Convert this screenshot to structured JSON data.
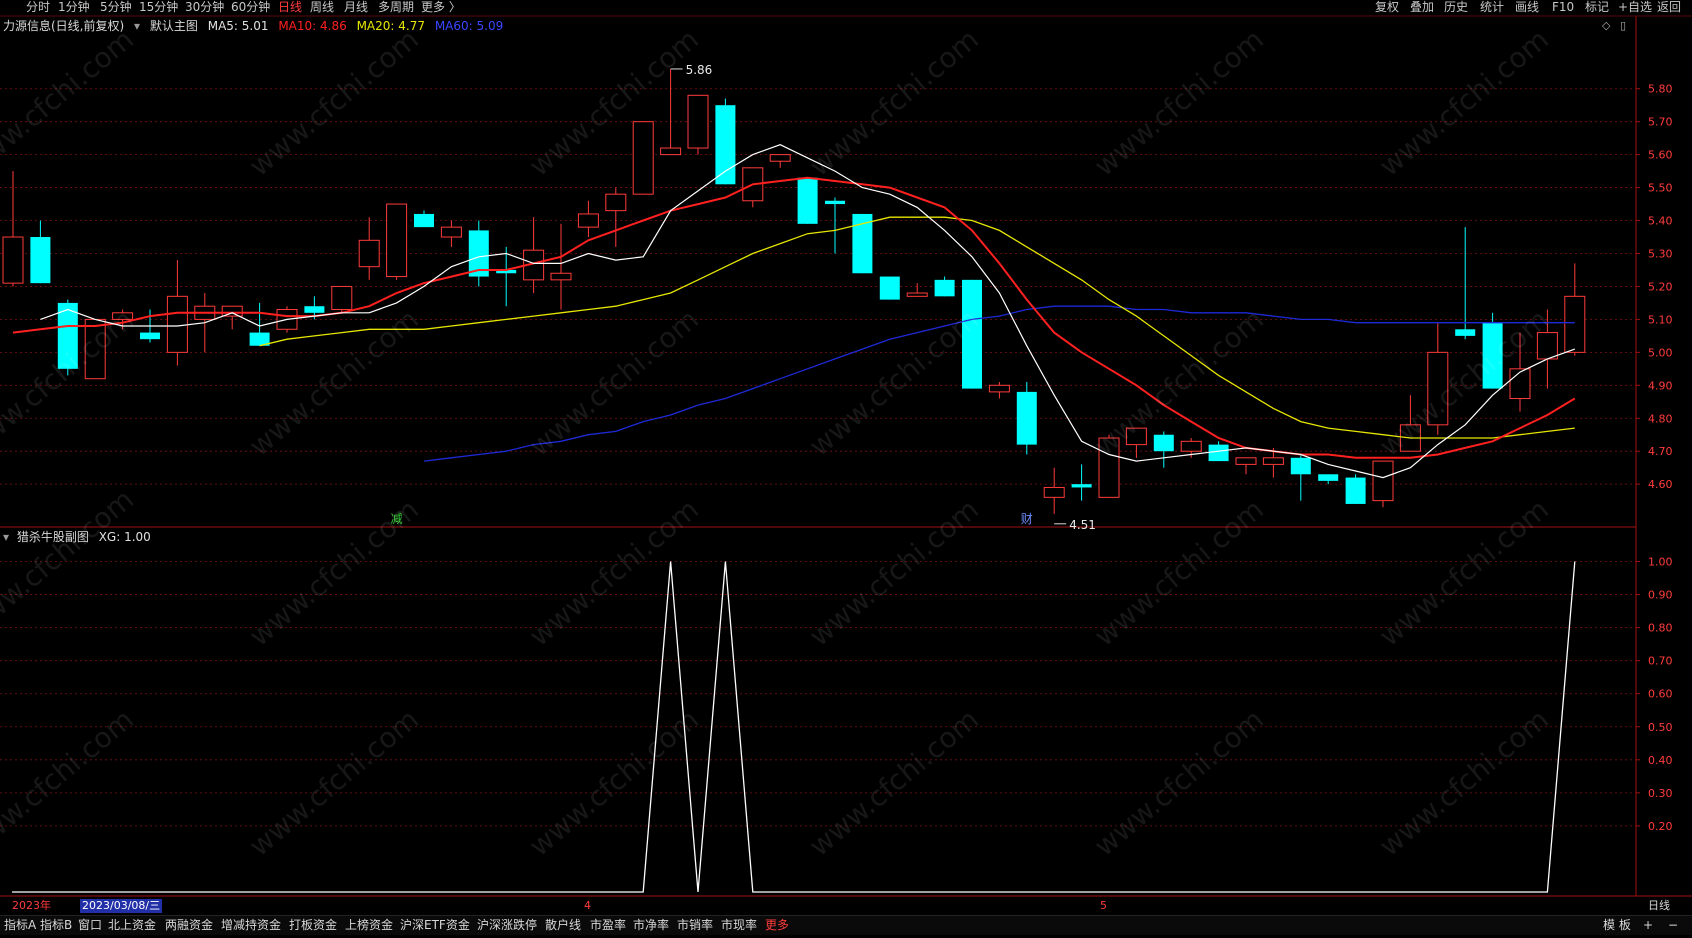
{
  "top_tabs": [
    "分时",
    "1分钟",
    "5分钟",
    "15分钟",
    "30分钟",
    "60分钟",
    "日线",
    "周线",
    "月线",
    "多周期",
    "更多 〉"
  ],
  "active_tab": "日线",
  "right_tools": [
    "复权",
    "叠加",
    "历史",
    "统计",
    "画线",
    "F10",
    "标记",
    "+自选",
    "返回"
  ],
  "main_title": {
    "stock": "力源信息(日线,前复权)",
    "template": "默认主图",
    "ma5": "MA5: 5.01",
    "ma10": "MA10: 4.86",
    "ma20": "MA20: 4.77",
    "ma60": "MA60: 5.09"
  },
  "sub_title": {
    "name": "猎杀牛股副图",
    "value": "XG: 1.00"
  },
  "markers": {
    "high": "5.86",
    "low": "4.51",
    "m1": "减",
    "m2": "财"
  },
  "date_bar": {
    "year": "2023年",
    "cursor_date": "2023/03/08/三",
    "m4": "4",
    "m5": "5",
    "period": "日线"
  },
  "bottom_tabs": [
    "指标A",
    "指标B",
    "窗口",
    "北上资金",
    "两融资金",
    "增减持资金",
    "打板资金",
    "上榜资金",
    "沪深ETF资金",
    "沪深涨跌停",
    "散户线",
    "市盈率",
    "市净率",
    "市销率",
    "市现率",
    "更多"
  ],
  "bottom_right": [
    "模 板",
    "+",
    "−"
  ],
  "watermark": "www.cfchi.com",
  "colors": {
    "up": "#ff3b3b",
    "down": "#00ffff",
    "ma5": "#ffffff",
    "ma10": "#ff2020",
    "ma20": "#e6e600",
    "ma60": "#1e2ad8",
    "grid": "#7a1010",
    "xg": "#ffffff"
  },
  "chart_data": [
    {
      "type": "candlestick",
      "title": "力源信息(日线,前复权)",
      "ylim": [
        4.47,
        5.96
      ],
      "y_ticks": [
        4.6,
        4.7,
        4.8,
        4.9,
        5.0,
        5.1,
        5.2,
        5.3,
        5.4,
        5.5,
        5.6,
        5.7,
        5.8
      ],
      "high_label": 5.86,
      "low_label": 4.51,
      "ohlc": [
        [
          5.21,
          5.55,
          5.2,
          5.35
        ],
        [
          5.35,
          5.4,
          5.21,
          5.21
        ],
        [
          5.15,
          5.16,
          4.93,
          4.95
        ],
        [
          4.92,
          5.1,
          4.92,
          5.1
        ],
        [
          5.1,
          5.13,
          5.07,
          5.12
        ],
        [
          5.06,
          5.13,
          5.03,
          5.04
        ],
        [
          5.0,
          5.28,
          4.96,
          5.17
        ],
        [
          5.1,
          5.18,
          5.0,
          5.14
        ],
        [
          5.11,
          5.14,
          5.07,
          5.14
        ],
        [
          5.06,
          5.15,
          5.02,
          5.02
        ],
        [
          5.07,
          5.14,
          5.06,
          5.13
        ],
        [
          5.14,
          5.17,
          5.1,
          5.12
        ],
        [
          5.13,
          5.2,
          5.12,
          5.2
        ],
        [
          5.26,
          5.41,
          5.22,
          5.34
        ],
        [
          5.23,
          5.45,
          5.22,
          5.45
        ],
        [
          5.42,
          5.43,
          5.38,
          5.38
        ],
        [
          5.35,
          5.4,
          5.32,
          5.38
        ],
        [
          5.37,
          5.4,
          5.2,
          5.23
        ],
        [
          5.25,
          5.32,
          5.14,
          5.24
        ],
        [
          5.22,
          5.41,
          5.18,
          5.31
        ],
        [
          5.22,
          5.39,
          5.13,
          5.24
        ],
        [
          5.38,
          5.46,
          5.35,
          5.42
        ],
        [
          5.43,
          5.5,
          5.32,
          5.48
        ],
        [
          5.48,
          5.7,
          5.48,
          5.7
        ],
        [
          5.6,
          5.86,
          5.6,
          5.62
        ],
        [
          5.62,
          5.78,
          5.6,
          5.78
        ],
        [
          5.75,
          5.77,
          5.51,
          5.51
        ],
        [
          5.46,
          5.56,
          5.44,
          5.56
        ],
        [
          5.58,
          5.6,
          5.56,
          5.6
        ],
        [
          5.53,
          5.53,
          5.39,
          5.39
        ],
        [
          5.46,
          5.47,
          5.3,
          5.45
        ],
        [
          5.42,
          5.42,
          5.24,
          5.24
        ],
        [
          5.23,
          5.23,
          5.16,
          5.16
        ],
        [
          5.17,
          5.21,
          5.17,
          5.18
        ],
        [
          5.22,
          5.23,
          5.17,
          5.17
        ],
        [
          5.22,
          5.22,
          4.89,
          4.89
        ],
        [
          4.88,
          4.91,
          4.86,
          4.9
        ],
        [
          4.88,
          4.91,
          4.69,
          4.72
        ],
        [
          4.56,
          4.65,
          4.51,
          4.59
        ],
        [
          4.6,
          4.66,
          4.55,
          4.59
        ],
        [
          4.56,
          4.75,
          4.56,
          4.74
        ],
        [
          4.72,
          4.77,
          4.68,
          4.77
        ],
        [
          4.75,
          4.76,
          4.65,
          4.7
        ],
        [
          4.7,
          4.74,
          4.68,
          4.73
        ],
        [
          4.72,
          4.73,
          4.67,
          4.67
        ],
        [
          4.66,
          4.68,
          4.63,
          4.68
        ],
        [
          4.66,
          4.71,
          4.62,
          4.68
        ],
        [
          4.68,
          4.69,
          4.55,
          4.63
        ],
        [
          4.63,
          4.63,
          4.6,
          4.61
        ],
        [
          4.62,
          4.63,
          4.54,
          4.54
        ],
        [
          4.55,
          4.67,
          4.53,
          4.67
        ],
        [
          4.7,
          4.87,
          4.7,
          4.78
        ],
        [
          4.78,
          5.09,
          4.75,
          5.0
        ],
        [
          5.07,
          5.38,
          5.04,
          5.05
        ],
        [
          5.09,
          5.12,
          4.89,
          4.89
        ],
        [
          4.86,
          5.06,
          4.82,
          4.95
        ],
        [
          4.98,
          5.13,
          4.89,
          5.06
        ],
        [
          5.0,
          5.27,
          4.99,
          5.17
        ]
      ],
      "ma5": [
        5.1,
        5.13,
        5.1,
        5.08,
        5.08,
        5.08,
        5.09,
        5.12,
        5.08,
        5.1,
        5.11,
        5.12,
        5.12,
        5.15,
        5.2,
        5.26,
        5.29,
        5.3,
        5.27,
        5.27,
        5.3,
        5.28,
        5.29,
        5.43,
        5.49,
        5.55,
        5.6,
        5.63,
        5.59,
        5.55,
        5.5,
        5.48,
        5.44,
        5.37,
        5.29,
        5.18,
        5.02,
        4.87,
        4.73,
        4.69,
        4.67,
        4.68,
        4.69,
        4.7,
        4.71,
        4.7,
        4.69,
        4.66,
        4.64,
        4.62,
        4.65,
        4.72,
        4.78,
        4.87,
        4.94,
        4.98,
        5.01
      ],
      "ma10": [
        5.06,
        5.07,
        5.08,
        5.08,
        5.09,
        5.11,
        5.12,
        5.12,
        5.12,
        5.12,
        5.11,
        5.11,
        5.12,
        5.14,
        5.18,
        5.21,
        5.23,
        5.25,
        5.25,
        5.27,
        5.29,
        5.34,
        5.37,
        5.4,
        5.43,
        5.45,
        5.47,
        5.51,
        5.52,
        5.53,
        5.52,
        5.51,
        5.5,
        5.47,
        5.44,
        5.37,
        5.27,
        5.16,
        5.06,
        5.0,
        4.95,
        4.9,
        4.84,
        4.79,
        4.74,
        4.71,
        4.7,
        4.69,
        4.69,
        4.68,
        4.68,
        4.68,
        4.69,
        4.71,
        4.73,
        4.77,
        4.81,
        4.86
      ],
      "ma20": [
        5.02,
        5.04,
        5.05,
        5.06,
        5.07,
        5.07,
        5.07,
        5.08,
        5.09,
        5.1,
        5.11,
        5.12,
        5.13,
        5.14,
        5.16,
        5.18,
        5.22,
        5.26,
        5.3,
        5.33,
        5.36,
        5.37,
        5.39,
        5.41,
        5.41,
        5.41,
        5.4,
        5.37,
        5.32,
        5.27,
        5.22,
        5.16,
        5.11,
        5.05,
        4.99,
        4.93,
        4.88,
        4.83,
        4.79,
        4.77,
        4.76,
        4.75,
        4.74,
        4.74,
        4.74,
        4.74,
        4.75,
        4.76,
        4.77
      ],
      "ma60": [
        4.67,
        4.68,
        4.69,
        4.7,
        4.72,
        4.73,
        4.75,
        4.76,
        4.79,
        4.81,
        4.84,
        4.86,
        4.89,
        4.92,
        4.95,
        4.98,
        5.01,
        5.04,
        5.06,
        5.08,
        5.1,
        5.11,
        5.13,
        5.14,
        5.14,
        5.14,
        5.13,
        5.13,
        5.12,
        5.12,
        5.12,
        5.11,
        5.1,
        5.1,
        5.09,
        5.09,
        5.09,
        5.09,
        5.09,
        5.09,
        5.09,
        5.09,
        5.09
      ]
    },
    {
      "type": "line",
      "title": "猎杀牛股副图",
      "ylim": [
        0,
        1.05
      ],
      "y_ticks": [
        0.2,
        0.3,
        0.4,
        0.5,
        0.6,
        0.7,
        0.8,
        0.9,
        1.0
      ],
      "series": [
        {
          "name": "XG",
          "values": [
            0,
            0,
            0,
            0,
            0,
            0,
            0,
            0,
            0,
            0,
            0,
            0,
            0,
            0,
            0,
            0,
            0,
            0,
            0,
            0,
            0,
            0,
            0,
            1,
            0,
            1,
            0,
            0,
            0,
            0,
            0,
            0,
            0,
            0,
            0,
            0,
            0,
            0,
            0,
            0,
            0,
            0,
            0,
            0,
            0,
            0,
            0,
            0,
            0,
            0,
            0,
            0,
            0,
            0,
            0,
            0,
            1
          ]
        }
      ]
    }
  ]
}
